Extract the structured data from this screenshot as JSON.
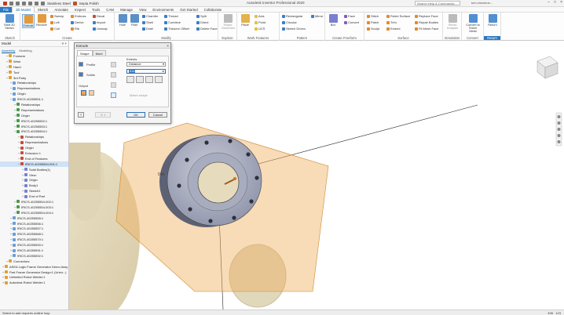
{
  "titlebar": {
    "quick_access": [
      "Stainless Steel",
      "Sepia Polish"
    ],
    "app_title": "Autodesk Inventor Professional 2020",
    "search_placeholder": "Search Help & Commands...",
    "user": "ben.checkme..."
  },
  "tabs": [
    "File",
    "3D Model",
    "Sketch",
    "Annotate",
    "Inspect",
    "Tools",
    "CAM",
    "Manage",
    "View",
    "Environments",
    "Get Started",
    "Collaborate"
  ],
  "ribbon": {
    "sketch": {
      "name": "Sketch",
      "start": "Start 2D Sketch"
    },
    "create": {
      "name": "Create",
      "extrude": "Extrude",
      "revolve": "Revolve",
      "col1": [
        "Sweep",
        "Loft",
        "Coil"
      ],
      "col2": [
        "Emboss",
        "Derive",
        "Rib"
      ],
      "col3": [
        "Decal",
        "Import",
        "Unwrap"
      ]
    },
    "modify": {
      "name": "Modify",
      "hole": "Hole",
      "fillet": "Fillet",
      "col1": [
        "Chamfer",
        "Shell",
        "Draft"
      ],
      "col2": [
        "Thread",
        "Combine",
        "Thicken/ Offset"
      ],
      "col3": [
        "Split",
        "Direct",
        "Delete Face"
      ]
    },
    "explore": {
      "name": "Explore",
      "shape_gen": "Shape Generator"
    },
    "work": {
      "name": "Work Features",
      "plane": "Plane",
      "col": [
        "Axis",
        "Point",
        "UCS"
      ]
    },
    "pattern": {
      "name": "Pattern",
      "col": [
        "Rectangular",
        "Circular",
        "Sketch Driven"
      ],
      "mirror": "Mirror"
    },
    "freeform": {
      "name": "Create Freeform",
      "box": "Box",
      "col": [
        "Face",
        "Convert"
      ]
    },
    "surface": {
      "name": "Surface",
      "col1": [
        "Stitch",
        "Patch",
        "Sculpt"
      ],
      "col2": [
        "Ruled Surface",
        "Trim",
        "Extend"
      ],
      "col3": [
        "Replace Face",
        "Repair Bodies",
        "Fit Mesh Face"
      ]
    },
    "simulation": {
      "name": "Simulation",
      "stress": "Stress Analysis"
    },
    "convert": {
      "name": "Convert",
      "sheet_metal": "Convert to Sheet Metal"
    },
    "return": {
      "name": "Return",
      "return": "Return"
    }
  },
  "browser": {
    "title": "Model",
    "tabs": [
      "Assembly",
      "Modeling"
    ],
    "rows": [
      {
        "label": "Forearm",
        "indent": 1
      },
      {
        "label": "Wrist",
        "indent": 1
      },
      {
        "label": "Hand",
        "indent": 1
      },
      {
        "label": "Tool",
        "indent": 1
      },
      {
        "label": "3rd Party",
        "indent": 1
      },
      {
        "label": "Relationships",
        "indent": 2
      },
      {
        "label": "Representations",
        "indent": 2
      },
      {
        "label": "Origin",
        "indent": 2
      },
      {
        "label": "IRICS-40255551:1",
        "indent": 2
      },
      {
        "label": "Relationships",
        "indent": 3
      },
      {
        "label": "Representations",
        "indent": 3
      },
      {
        "label": "Origin",
        "indent": 3
      },
      {
        "label": "IRICS-40255552:1",
        "indent": 3
      },
      {
        "label": "IRICS-40255553:1",
        "indent": 3
      },
      {
        "label": "IRICS-40255554:1",
        "indent": 3
      },
      {
        "label": "Relationships",
        "indent": 4
      },
      {
        "label": "Representations",
        "indent": 4
      },
      {
        "label": "Origin",
        "indent": 4
      },
      {
        "label": "Extrusion 1",
        "indent": 4
      },
      {
        "label": "End of Features",
        "indent": 4
      },
      {
        "label": "IRICS-40255554-001:1",
        "indent": 4,
        "selected": true
      },
      {
        "label": "Solid Bodies(1)",
        "indent": 5
      },
      {
        "label": "View:",
        "indent": 5
      },
      {
        "label": "Origin",
        "indent": 5
      },
      {
        "label": "Body1",
        "indent": 5
      },
      {
        "label": "Sketch1",
        "indent": 5
      },
      {
        "label": "End of Part",
        "indent": 5
      },
      {
        "label": "IRICS-40255554-002:1",
        "indent": 3
      },
      {
        "label": "IRICS-40255554-003:1",
        "indent": 3
      },
      {
        "label": "IRICS-40255554-004:1",
        "indent": 3
      },
      {
        "label": "IRICS-40255555:1",
        "indent": 2
      },
      {
        "label": "IRICS-40255556:1",
        "indent": 2
      },
      {
        "label": "IRICS-40255557:1",
        "indent": 2
      },
      {
        "label": "IRICS-40255568:1",
        "indent": 2
      },
      {
        "label": "IRICS-40255570:1",
        "indent": 2
      },
      {
        "label": "IRICS-40255590:1",
        "indent": 2
      },
      {
        "label": "IRICS-40255591:1",
        "indent": 2
      },
      {
        "label": "IRICS-40255592:1",
        "indent": 2
      },
      {
        "label": "Connectors",
        "indent": 1
      },
      {
        "label": "ASEA Logic Frame Generator Demo Assy",
        "indent": 0
      },
      {
        "label": "Part Frame Generator Design:1 (Uninr...)",
        "indent": 0
      },
      {
        "label": "Unlimited Robot Welder:1",
        "indent": 0
      },
      {
        "label": "Autodesk Robot Welder:1",
        "indent": 0
      }
    ]
  },
  "dialog": {
    "title": "Extrude",
    "tabs": [
      "Shape",
      "More"
    ],
    "profile": "Profile",
    "solids": "Solids",
    "output": "Output",
    "extents": "Extents",
    "extents_value": "Distance",
    "distance_value": "4 in",
    "match_shape": "Match shape",
    "ok": "OK",
    "cancel": "Cancel",
    "dimension": "0 in",
    "help": "?"
  },
  "status": {
    "message": "Select to add requires outline loop",
    "count1": "495",
    "count2": "123"
  }
}
